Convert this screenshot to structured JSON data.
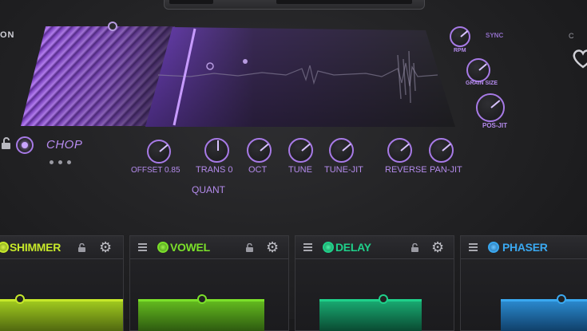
{
  "header": {
    "left_label": "ON",
    "right_label": "C"
  },
  "engine": {
    "mode_label": "CHOP",
    "quant_label": "QUANT",
    "sync_label": "SYNC",
    "knobs": [
      {
        "label": "OFFSET 0.85",
        "value": 0.85
      },
      {
        "label": "TRANS 0"
      },
      {
        "label": "OCT"
      },
      {
        "label": "TUNE"
      },
      {
        "label": "TUNE-JIT"
      },
      {
        "label": "REVERSE"
      },
      {
        "label": "PAN-JIT"
      }
    ],
    "side_knobs": [
      {
        "label": "RPM"
      },
      {
        "label": "GRAIN SIZE"
      },
      {
        "label": "POS-JIT"
      }
    ]
  },
  "effects": [
    {
      "name": "SHIMMER",
      "color": "#c6e82a"
    },
    {
      "name": "VOWEL",
      "color": "#7be02a"
    },
    {
      "name": "DELAY",
      "color": "#1fd08a"
    },
    {
      "name": "PHASER",
      "color": "#3aa8f0"
    }
  ],
  "colors": {
    "accent": "#a77ae6",
    "accent_light": "#c9a5ff",
    "background": "#1e1e20"
  },
  "icons": {
    "lock": "lock-icon",
    "gear": "gear-icon",
    "menu": "menu-icon",
    "power": "power-icon"
  }
}
